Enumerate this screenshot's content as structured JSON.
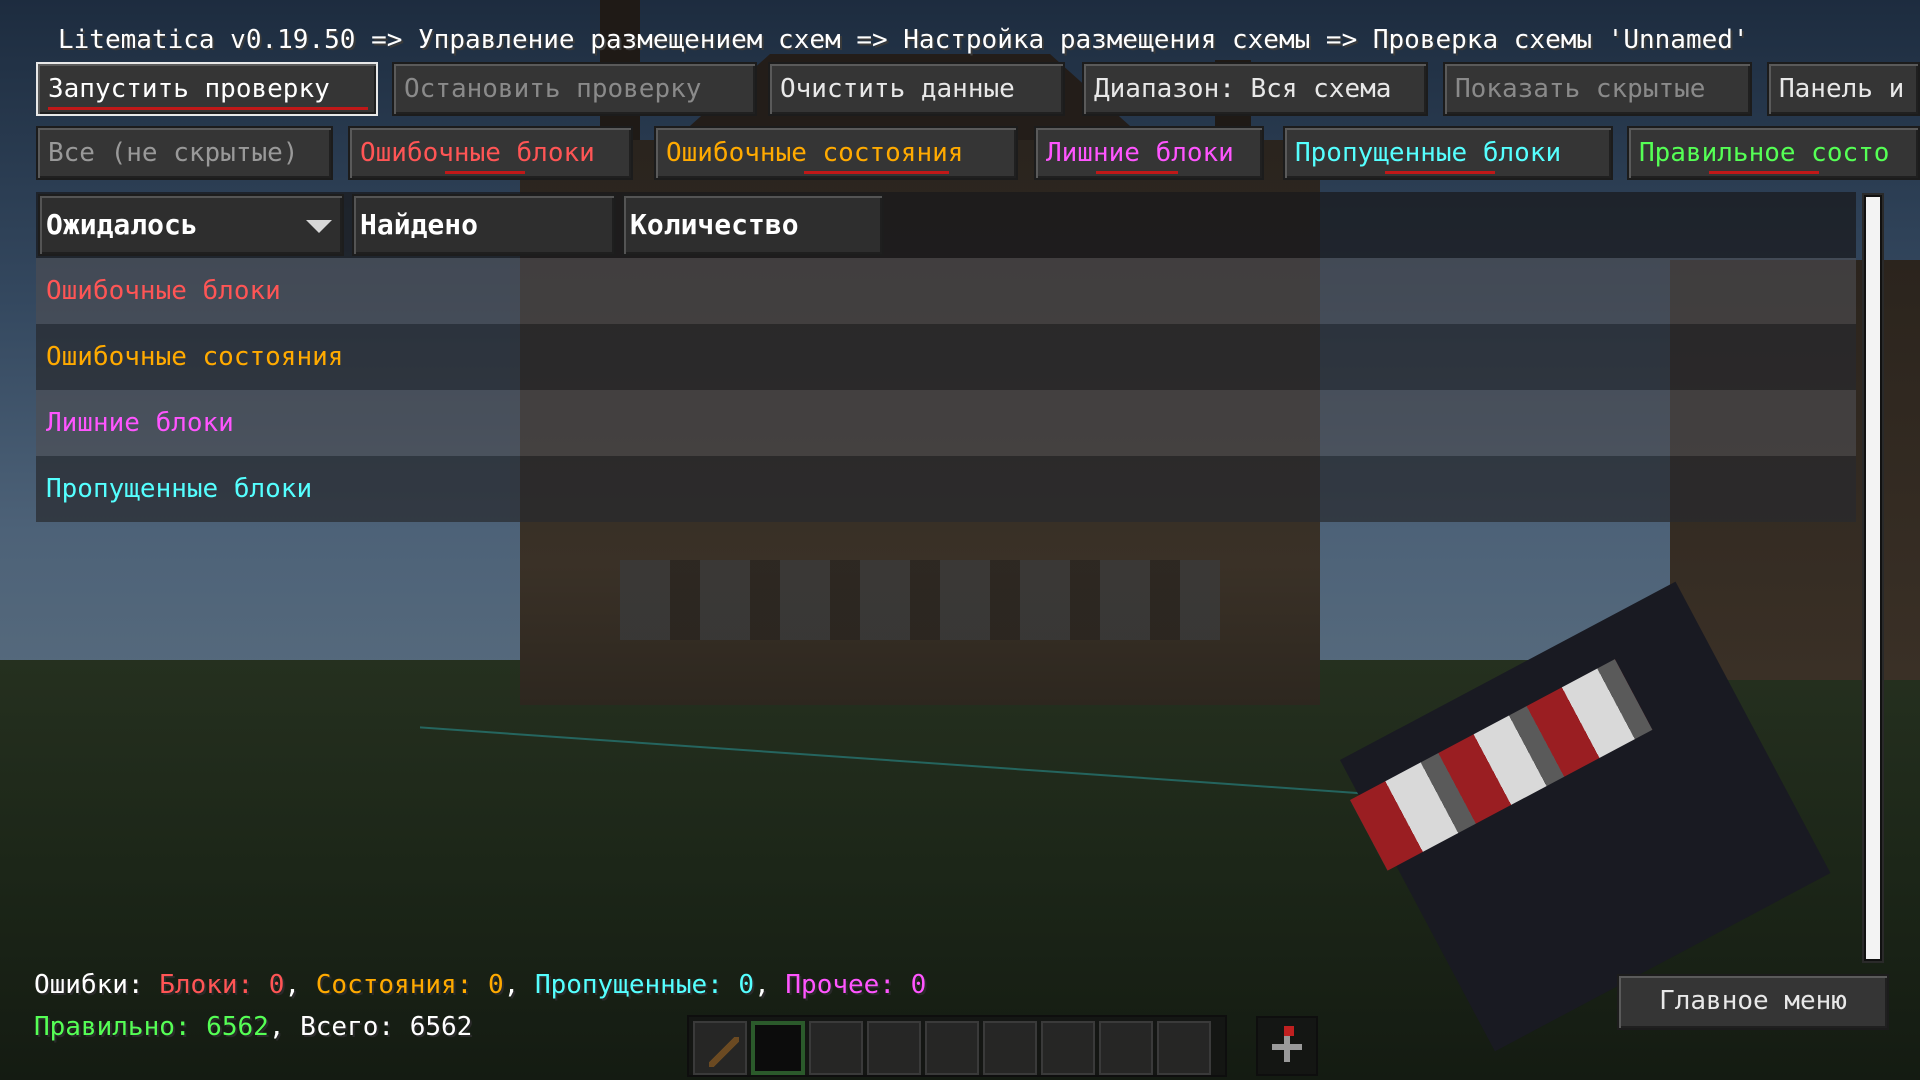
{
  "title": "Litematica v0.19.50 => Управление размещением схем => Настройка размещения схемы => Проверка схемы 'Unnamed'",
  "toolbar": {
    "start": "Запустить проверку",
    "stop": "Остановить проверку",
    "clear": "Очистить данные",
    "range": "Диапазон: Вся схема",
    "show_hidden": "Показать скрытые",
    "panel": "Панель и"
  },
  "filters": {
    "all": "Все (не скрытые)",
    "wrong_blocks": "Ошибочные блоки",
    "wrong_states": "Ошибочные состояния",
    "extra": "Лишние блоки",
    "missing": "Пропущенные блоки",
    "correct": "Правильное состо"
  },
  "table": {
    "headers": [
      "Ожидалось",
      "Найдено",
      "Количество"
    ],
    "rows": [
      "Ошибочные блоки",
      "Ошибочные состояния",
      "Лишние блоки",
      "Пропущенные блоки"
    ]
  },
  "status": {
    "errors_label": "Ошибки: ",
    "blocks": "Блоки: 0",
    "states": "Состояния: 0",
    "missing": "Пропущенные: 0",
    "other": "Прочее: 0",
    "sep": ", ",
    "correct": "Правильно: 6562",
    "total": ", Всего: 6562"
  },
  "main_menu": "Главное меню",
  "colors": {
    "wrong_blocks": "#ff5555",
    "wrong_states": "#ffaa00",
    "extra": "#ff55ff",
    "missing": "#55ffff",
    "correct": "#55ff55",
    "underline": "#c01818"
  },
  "icons": {
    "sort": "triangle-down-icon",
    "offhand": "compass-icon"
  }
}
